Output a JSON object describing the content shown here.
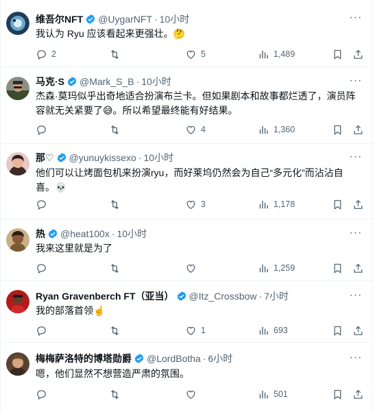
{
  "tweets": [
    {
      "name": "维吾尔NFT",
      "handle": "@UygarNFT",
      "time": "10小时",
      "text": "我认为 Ryu 应该看起来更强壮。🤔",
      "replies": "2",
      "likes": "5",
      "views": "1,489"
    },
    {
      "name": "马克·S",
      "handle": "@Mark_S_B",
      "time": "10小时",
      "text": "杰森·莫玛似乎出奇地适合扮演布兰卡。但如果剧本和故事都烂透了，演员阵容就无关紧要了😅。所以希望最终能有好结果。",
      "replies": "",
      "likes": "4",
      "views": "1,360"
    },
    {
      "name": "那♡",
      "handle": "@yunuykissexo",
      "time": "10小时",
      "text": "他们可以让烤面包机来扮演ryu，而好莱坞仍然会为自己“多元化”而沾沾自喜。💀",
      "replies": "",
      "likes": "3",
      "views": "1,178"
    },
    {
      "name": "热",
      "handle": "@heat100x",
      "time": "10小时",
      "text": "我来这里就是为了",
      "replies": "",
      "likes": "",
      "views": "1,259"
    },
    {
      "name": "Ryan Gravenberch FT（亚当）",
      "handle": "@Itz_Crossbow",
      "time": "7小时",
      "text": "我的部落首领☝️",
      "replies": "",
      "likes": "1",
      "views": "693"
    },
    {
      "name": "梅梅萨洛特的博塔勋爵",
      "handle": "@LordBotha",
      "time": "6小时",
      "text": "嗯，他们显然不想营造严肃的氛围。",
      "replies": "",
      "likes": "",
      "views": "501"
    }
  ],
  "separator": "·",
  "more_glyph": "···",
  "icons": [
    "reply-icon",
    "retweet-icon",
    "like-icon",
    "views-icon",
    "bookmark-icon",
    "share-icon",
    "verified-badge-icon",
    "more-icon"
  ],
  "colors": {
    "verified": "#1d9bf0",
    "muted": "#536471",
    "text": "#0f1419",
    "border": "#eff3f4"
  }
}
